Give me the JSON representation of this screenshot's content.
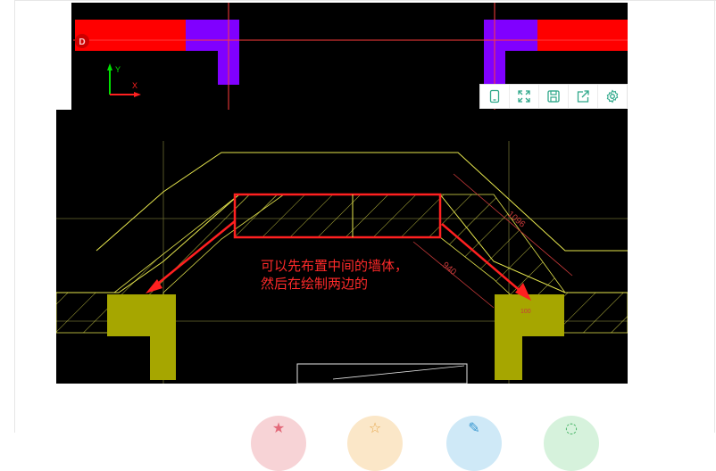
{
  "canvas": {
    "d_badge": "D",
    "axis_y": "Y",
    "axis_x": "X",
    "annotation_line1": "可以先布置中间的墙体，",
    "annotation_line2": "然后在绘制两边的",
    "dim_top": "1096",
    "dim_mid": "940",
    "dim_small": "100"
  },
  "toolbar": {
    "buttons": [
      {
        "icon": "tablet-icon"
      },
      {
        "icon": "fullscreen-icon"
      },
      {
        "icon": "save-icon"
      },
      {
        "icon": "share-icon"
      },
      {
        "icon": "gear-icon"
      }
    ]
  },
  "colors": {
    "canvas_bg": "#000000",
    "wall_red": "#ff0000",
    "wall_purple": "#8000ff",
    "column_olive": "#a6a600",
    "cad_yellow": "#e6e64d",
    "annotation_red": "#ff2a2a",
    "toolbar_icon": "#2fa88a"
  },
  "bottom_bar": {
    "icons": [
      {
        "icon": "star-icon",
        "color": "#f7d3d6"
      },
      {
        "icon": "favorite-icon",
        "color": "#fbe7c8"
      },
      {
        "icon": "edit-icon",
        "color": "#cfe9f7"
      },
      {
        "icon": "chat-icon",
        "color": "#d6f2dc"
      }
    ]
  }
}
